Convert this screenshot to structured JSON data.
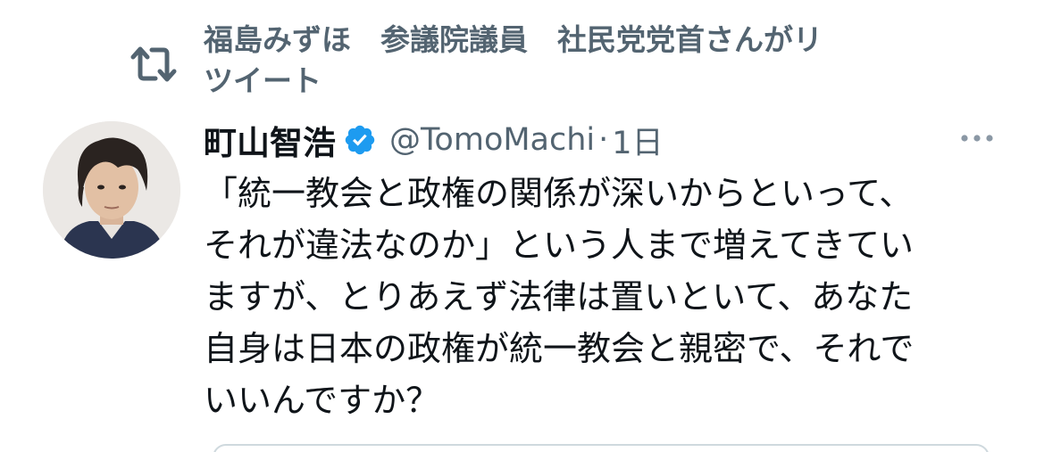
{
  "retweet": {
    "icon": "retweet-icon",
    "line1": "福島みずほ　参議院議員　社民党党首さんがリ",
    "line2": "ツイート"
  },
  "tweet": {
    "display_name": "町山智浩",
    "verified": true,
    "verified_icon": "verified-badge-icon",
    "handle": "@TomoMachi",
    "separator": "·",
    "time": "1日",
    "more_icon": "more-options-icon",
    "text_lines": [
      "「統一教会と政権の関係が深いからといって、",
      "それが違法なのか」という人まで増えてきてい",
      "ますが、とりあえず法律は置いといて、あなた",
      "自身は日本の政権が統一教会と親密で、それで",
      "いいんですか？"
    ]
  },
  "colors": {
    "text_primary": "#0f1419",
    "text_secondary": "#536471",
    "verified_blue": "#1d9bf0",
    "border": "#cfd9de"
  }
}
